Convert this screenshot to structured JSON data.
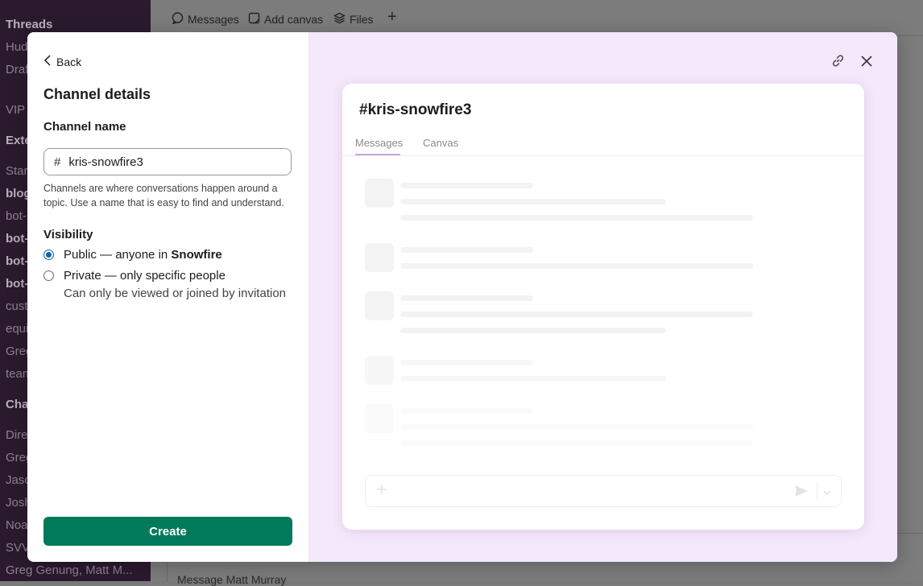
{
  "background": {
    "sidebar_items": [
      {
        "label": "Threads",
        "bold": true
      },
      {
        "label": "Hud",
        "bold": false
      },
      {
        "label": "Draf",
        "bold": false
      },
      {
        "label": "VIP",
        "bold": false
      },
      {
        "label": "Exte",
        "bold": true
      },
      {
        "label": "Star",
        "bold": false
      },
      {
        "label": "blog",
        "bold": true
      },
      {
        "label": "bot-",
        "bold": false
      },
      {
        "label": "bot-",
        "bold": true
      },
      {
        "label": "bot-",
        "bold": true
      },
      {
        "label": "bot-",
        "bold": true
      },
      {
        "label": "cust",
        "bold": false
      },
      {
        "label": "equi",
        "bold": false
      },
      {
        "label": "Greg",
        "bold": false
      },
      {
        "label": "team",
        "bold": false
      },
      {
        "label": "Cha",
        "bold": true
      },
      {
        "label": "Dire",
        "bold": false
      },
      {
        "label": "Greg",
        "bold": false
      },
      {
        "label": "Jaso",
        "bold": false
      },
      {
        "label": "Josh",
        "bold": false
      },
      {
        "label": "Noa",
        "bold": false
      },
      {
        "label": "SVV",
        "bold": false
      },
      {
        "label": "Greg Genung, Matt M...",
        "bold": false
      }
    ],
    "tabs": {
      "messages": "Messages",
      "add_canvas": "Add canvas",
      "files": "Files",
      "add": "+"
    },
    "composer_placeholder": "Message Matt Murray"
  },
  "modal": {
    "back_label": "Back",
    "title": "Channel details",
    "channel_name_label": "Channel name",
    "channel_name_prefix": "#",
    "channel_name_value": "kris-snowfire3",
    "help_text": "Channels are where conversations happen around a topic. Use a name that is easy to find and understand.",
    "visibility_label": "Visibility",
    "public_option": {
      "prefix": "Public — anyone in ",
      "workspace": "Snowfire",
      "checked": true
    },
    "private_option": {
      "label": "Private — only specific people",
      "sub": "Can only be viewed or joined by invitation",
      "checked": false
    },
    "create_label": "Create",
    "accent_color": "#007a5a"
  },
  "preview": {
    "channel_title": "#kris-snowfire3",
    "tabs": [
      "Messages",
      "Canvas"
    ],
    "active_tab": "Messages",
    "background_color": "#f5e8fb"
  }
}
